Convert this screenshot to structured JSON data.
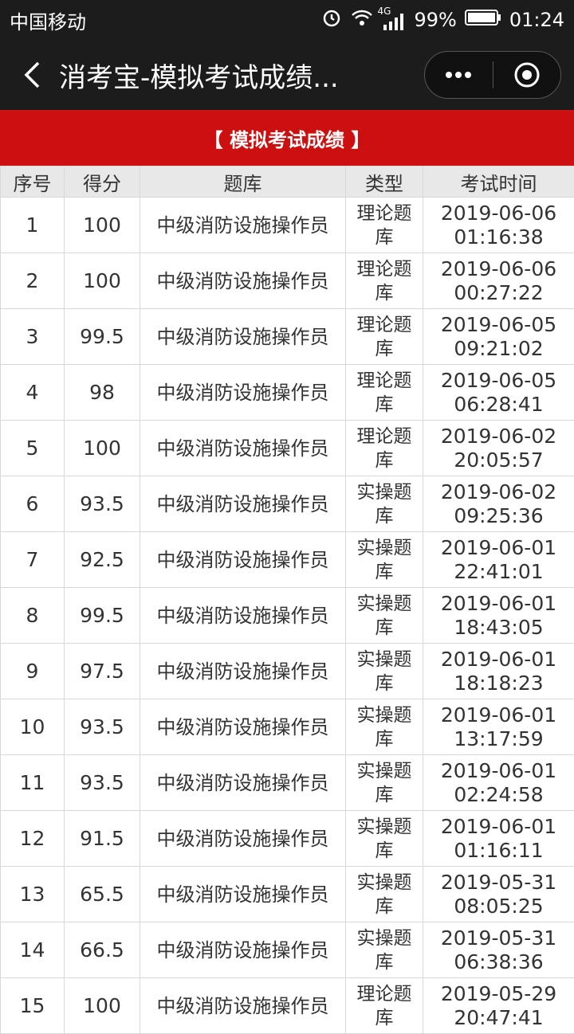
{
  "status_bar": {
    "carrier": "中国移动",
    "network": "4G",
    "battery": "99%",
    "time": "01:24"
  },
  "nav": {
    "title": "消考宝-模拟考试成绩..."
  },
  "banner": {
    "title": "【 模拟考试成绩 】"
  },
  "table": {
    "headers": [
      "序号",
      "得分",
      "题库",
      "类型",
      "考试时间"
    ],
    "rows": [
      {
        "no": "1",
        "score": "100",
        "bank": "中级消防设施操作员",
        "type": "理论题库",
        "date": "2019-06-06",
        "time": "01:16:38"
      },
      {
        "no": "2",
        "score": "100",
        "bank": "中级消防设施操作员",
        "type": "理论题库",
        "date": "2019-06-06",
        "time": "00:27:22"
      },
      {
        "no": "3",
        "score": "99.5",
        "bank": "中级消防设施操作员",
        "type": "理论题库",
        "date": "2019-06-05",
        "time": "09:21:02"
      },
      {
        "no": "4",
        "score": "98",
        "bank": "中级消防设施操作员",
        "type": "理论题库",
        "date": "2019-06-05",
        "time": "06:28:41"
      },
      {
        "no": "5",
        "score": "100",
        "bank": "中级消防设施操作员",
        "type": "理论题库",
        "date": "2019-06-02",
        "time": "20:05:57"
      },
      {
        "no": "6",
        "score": "93.5",
        "bank": "中级消防设施操作员",
        "type": "实操题库",
        "date": "2019-06-02",
        "time": "09:25:36"
      },
      {
        "no": "7",
        "score": "92.5",
        "bank": "中级消防设施操作员",
        "type": "实操题库",
        "date": "2019-06-01",
        "time": "22:41:01"
      },
      {
        "no": "8",
        "score": "99.5",
        "bank": "中级消防设施操作员",
        "type": "实操题库",
        "date": "2019-06-01",
        "time": "18:43:05"
      },
      {
        "no": "9",
        "score": "97.5",
        "bank": "中级消防设施操作员",
        "type": "实操题库",
        "date": "2019-06-01",
        "time": "18:18:23"
      },
      {
        "no": "10",
        "score": "93.5",
        "bank": "中级消防设施操作员",
        "type": "实操题库",
        "date": "2019-06-01",
        "time": "13:17:59"
      },
      {
        "no": "11",
        "score": "93.5",
        "bank": "中级消防设施操作员",
        "type": "实操题库",
        "date": "2019-06-01",
        "time": "02:24:58"
      },
      {
        "no": "12",
        "score": "91.5",
        "bank": "中级消防设施操作员",
        "type": "实操题库",
        "date": "2019-06-01",
        "time": "01:16:11"
      },
      {
        "no": "13",
        "score": "65.5",
        "bank": "中级消防设施操作员",
        "type": "实操题库",
        "date": "2019-05-31",
        "time": "08:05:25"
      },
      {
        "no": "14",
        "score": "66.5",
        "bank": "中级消防设施操作员",
        "type": "实操题库",
        "date": "2019-05-31",
        "time": "06:38:36"
      },
      {
        "no": "15",
        "score": "100",
        "bank": "中级消防设施操作员",
        "type": "理论题库",
        "date": "2019-05-29",
        "time": "20:47:41"
      }
    ]
  }
}
